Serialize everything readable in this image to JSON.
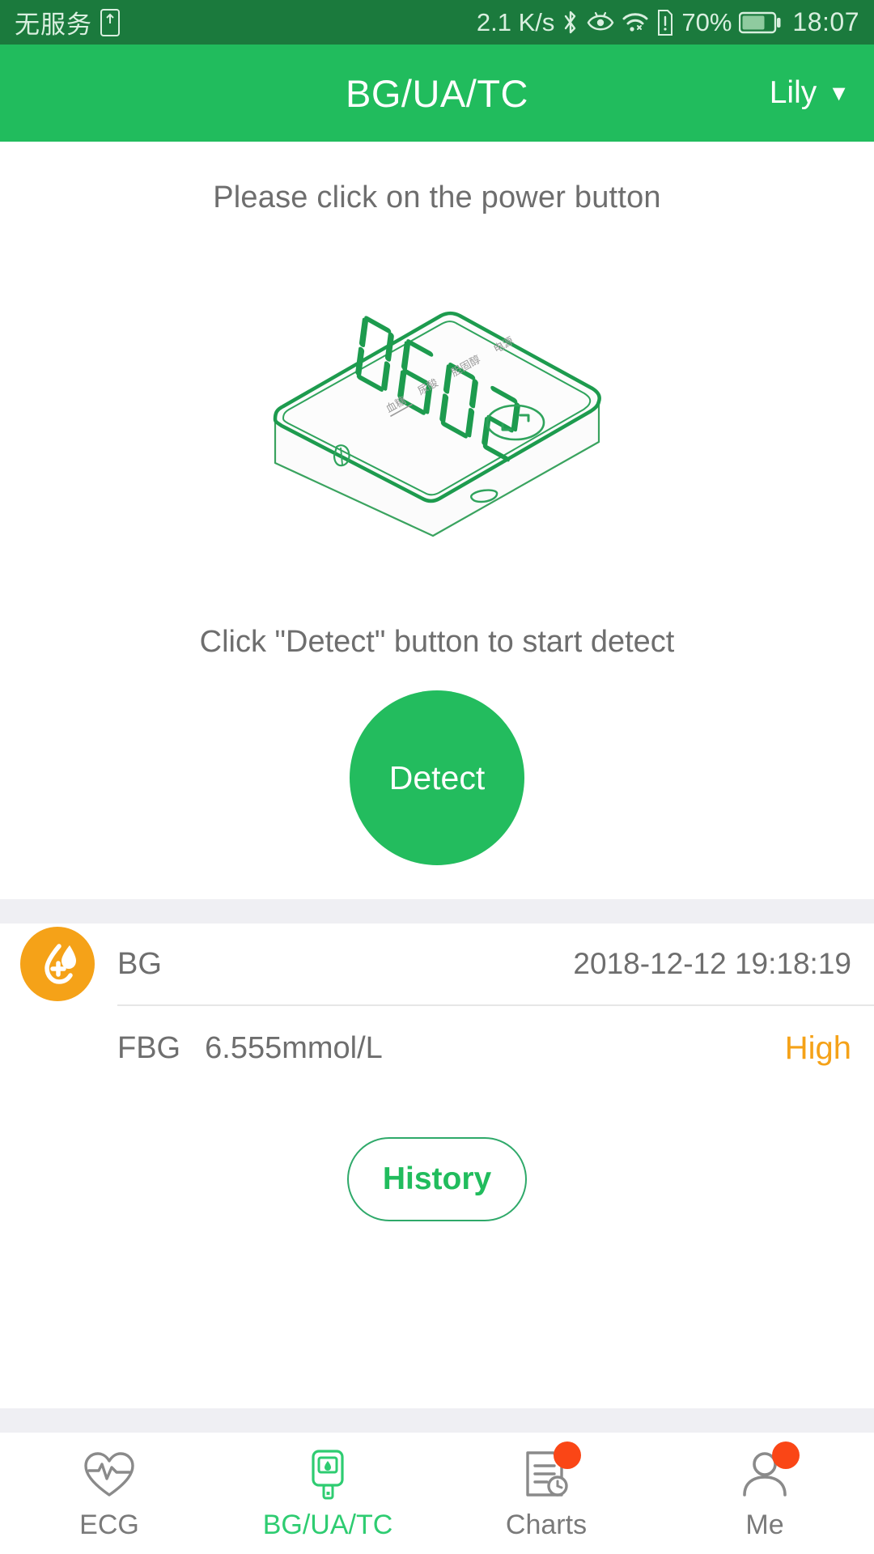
{
  "status_bar": {
    "carrier": "无服务",
    "sim_icon": "sim-card-icon",
    "network_speed": "2.1 K/s",
    "bluetooth_icon": "bluetooth-icon",
    "eye_icon": "eye-care-icon",
    "wifi_icon": "wifi-icon",
    "alert_icon": "sd-card-alert-icon",
    "battery_percent": "70%",
    "battery_icon": "battery-icon",
    "time": "18:07"
  },
  "app_bar": {
    "title": "BG/UA/TC",
    "user_name": "Lily",
    "caret": "▼"
  },
  "main": {
    "hint_power": "Please click on the power button",
    "device": {
      "display_value": "0602",
      "labels": [
        "血糖",
        "尿酸",
        "胆固醇",
        "电源"
      ]
    },
    "hint_detect": "Click \"Detect\" button to start detect",
    "detect_label": "Detect"
  },
  "result_card": {
    "icon": "blood-drop-icon",
    "type": "BG",
    "timestamp": "2018-12-12 19:18:19",
    "measure_label": "FBG",
    "measure_value": "6.555mmol/L",
    "status": "High",
    "history_label": "History"
  },
  "tabs": [
    {
      "label": "ECG",
      "icon": "heart-pulse-icon",
      "active": false,
      "badge": false
    },
    {
      "label": "BG/UA/TC",
      "icon": "glucose-meter-icon",
      "active": true,
      "badge": false
    },
    {
      "label": "Charts",
      "icon": "report-clock-icon",
      "active": false,
      "badge": true
    },
    {
      "label": "Me",
      "icon": "person-icon",
      "active": false,
      "badge": true
    }
  ],
  "colors": {
    "status_bar_green": "#1B7A3D",
    "brand_green": "#21BC5D",
    "accent_orange": "#F5A218",
    "badge_red": "#FA4616",
    "band_gray": "#EFEFF3",
    "text_gray": "#6E6E6E"
  }
}
